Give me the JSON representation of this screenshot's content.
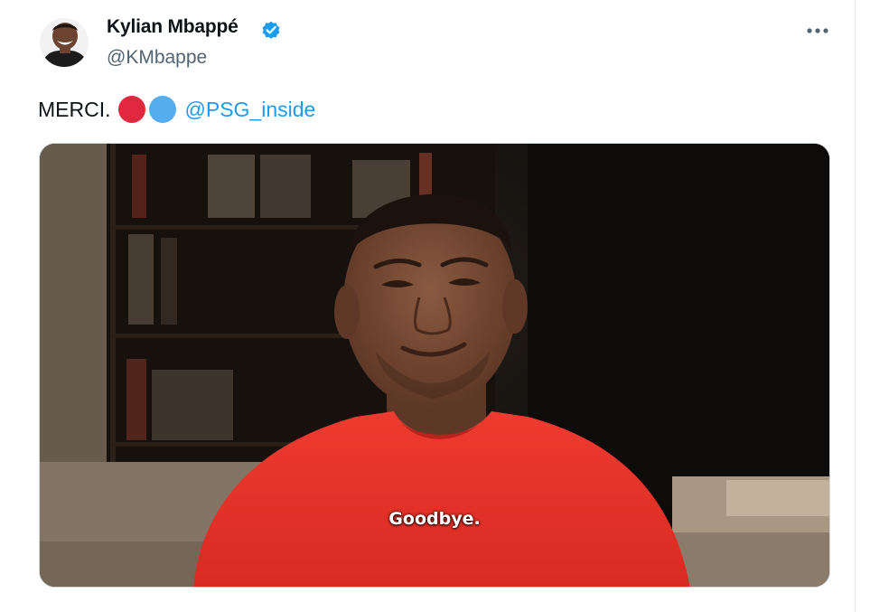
{
  "tweet": {
    "author": {
      "display_name": "Kylian Mbappé",
      "handle": "@KMbappe",
      "verified": true,
      "verified_color": "#1d9bf0"
    },
    "text": {
      "word": "MERCI.",
      "emoji": [
        {
          "name": "red-circle",
          "color": "#e0283f"
        },
        {
          "name": "blue-circle",
          "color": "#55acee"
        }
      ],
      "mention": "@PSG_inside"
    },
    "media": {
      "type": "video",
      "subtitle": "Goodbye."
    },
    "more_icon": "more-horizontal-icon"
  },
  "colors": {
    "mention": "#1d9bf0",
    "secondary_text": "#536471",
    "shirt": "#e8322a"
  }
}
